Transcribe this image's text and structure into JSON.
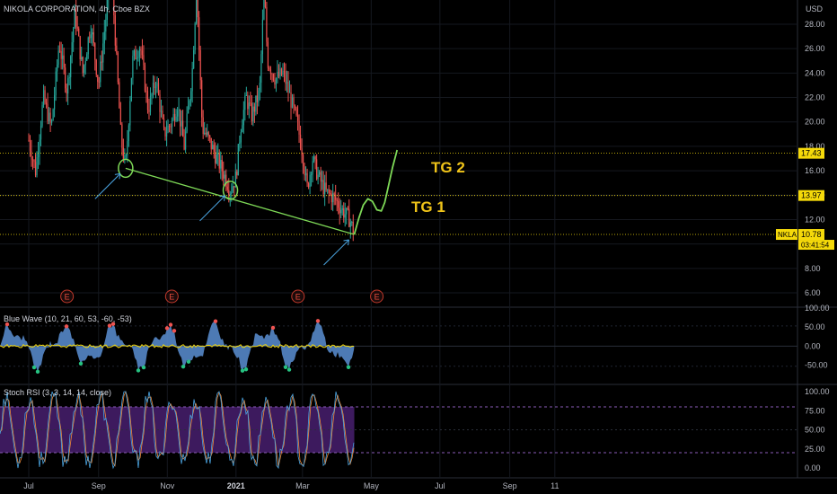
{
  "chart_data": [
    {
      "type": "candlestick",
      "title": "NIKOLA CORPORATION, 4h, Cboe BZX",
      "currency": "USD",
      "x_ticks": [
        "Jul",
        "Sep",
        "Nov",
        "2021",
        "Mar",
        "May",
        "Jul",
        "Sep",
        "11"
      ],
      "y_ticks": [
        6.0,
        8.0,
        10.0,
        12.0,
        14.0,
        16.0,
        18.0,
        20.0,
        22.0,
        24.0,
        26.0,
        28.0
      ],
      "ylim": [
        5.0,
        29.3
      ],
      "price_levels": [
        {
          "label": "17.43",
          "value": 17.43,
          "color": "#f5d90a"
        },
        {
          "label": "13.97",
          "value": 13.97,
          "color": "#f5d90a"
        },
        {
          "label": "10.78",
          "value": 10.78,
          "color": "#f5d90a"
        }
      ],
      "last_price": {
        "symbol": "NKLA",
        "price": "10.78",
        "countdown": "03:41:54"
      },
      "price_path": [
        [
          "2020-07-01",
          18.5
        ],
        [
          "2020-07-07",
          16.0
        ],
        [
          "2020-07-14",
          22.0
        ],
        [
          "2020-07-21",
          19.5
        ],
        [
          "2020-07-28",
          26.5
        ],
        [
          "2020-08-04",
          22.5
        ],
        [
          "2020-08-11",
          29.0
        ],
        [
          "2020-08-18",
          24.0
        ],
        [
          "2020-08-25",
          28.0
        ],
        [
          "2020-09-01",
          23.0
        ],
        [
          "2020-09-08",
          29.0
        ],
        [
          "2020-09-12",
          33.0
        ],
        [
          "2020-09-21",
          18.5
        ],
        [
          "2020-09-25",
          16.2
        ],
        [
          "2020-10-01",
          25.0
        ],
        [
          "2020-10-08",
          26.3
        ],
        [
          "2020-10-15",
          21.0
        ],
        [
          "2020-10-22",
          23.5
        ],
        [
          "2020-10-29",
          19.0
        ],
        [
          "2020-11-05",
          20.0
        ],
        [
          "2020-11-10",
          21.5
        ],
        [
          "2020-11-16",
          18.0
        ],
        [
          "2020-11-23",
          24.0
        ],
        [
          "2020-11-27",
          31.0
        ],
        [
          "2020-12-02",
          19.5
        ],
        [
          "2020-12-08",
          18.5
        ],
        [
          "2020-12-14",
          17.2
        ],
        [
          "2020-12-20",
          16.0
        ],
        [
          "2020-12-27",
          14.4
        ],
        [
          "2021-01-01",
          15.5
        ],
        [
          "2021-01-05",
          19.5
        ],
        [
          "2021-01-10",
          22.0
        ],
        [
          "2021-01-15",
          20.5
        ],
        [
          "2021-01-22",
          22.5
        ],
        [
          "2021-01-26",
          31.0
        ],
        [
          "2021-01-29",
          25.0
        ],
        [
          "2021-02-05",
          23.5
        ],
        [
          "2021-02-12",
          24.0
        ],
        [
          "2021-02-18",
          22.0
        ],
        [
          "2021-02-24",
          20.0
        ],
        [
          "2021-03-01",
          17.5
        ],
        [
          "2021-03-05",
          14.5
        ],
        [
          "2021-03-10",
          17.0
        ],
        [
          "2021-03-15",
          15.5
        ],
        [
          "2021-03-22",
          14.2
        ],
        [
          "2021-03-29",
          13.8
        ],
        [
          "2021-04-05",
          12.8
        ],
        [
          "2021-04-12",
          12.0
        ],
        [
          "2021-04-16",
          10.78
        ]
      ],
      "trend_line": [
        [
          "2020-09-25",
          16.2
        ],
        [
          "2021-04-16",
          10.78
        ]
      ],
      "target_path": [
        [
          "2021-04-16",
          10.78
        ],
        [
          "2021-04-20",
          12.1
        ],
        [
          "2021-04-24",
          13.2
        ],
        [
          "2021-04-28",
          13.7
        ],
        [
          "2021-05-02",
          13.5
        ],
        [
          "2021-05-06",
          12.8
        ],
        [
          "2021-05-10",
          12.7
        ],
        [
          "2021-05-13",
          13.4
        ],
        [
          "2021-05-16",
          14.6
        ],
        [
          "2021-05-20",
          16.3
        ],
        [
          "2021-05-24",
          17.7
        ]
      ],
      "circle_markers": [
        [
          "2020-09-25",
          16.2
        ],
        [
          "2020-12-27",
          14.4
        ]
      ],
      "arrow_markers": [
        [
          "2020-09-25",
          16.2
        ],
        [
          "2020-12-27",
          14.4
        ],
        [
          "2021-04-16",
          10.78
        ]
      ],
      "annotations": [
        {
          "text": "TG 1",
          "color": "#f0c419"
        },
        {
          "text": "TG 2",
          "color": "#f0c419"
        }
      ],
      "earnings_markers": [
        {
          "label": "E",
          "date": "2020-08-04"
        },
        {
          "label": "E",
          "date": "2020-11-05"
        },
        {
          "label": "E",
          "date": "2021-02-25"
        },
        {
          "label": "E",
          "date": "2021-05-06"
        }
      ],
      "colors": {
        "up": "#26a69a",
        "down": "#ef5350",
        "trend_line": "#7ed957",
        "price_level": "#f5d90a",
        "circle": "#7ed957",
        "arrow": "#4aa3df"
      }
    },
    {
      "type": "area",
      "title": "Blue Wave (10, 21, 60, 53, -60, -53)",
      "y_ticks": [
        100.0,
        50.0,
        0.0,
        -50.0
      ],
      "y_tick_labels": [
        "100.00",
        "50.00",
        "0.00",
        "-50.00"
      ],
      "ylim": [
        -80,
        110
      ],
      "levels": [
        53,
        -53
      ],
      "colors": {
        "fill": "#5b8fd4",
        "signal": "#f5d90a",
        "overbought_dot": "#ef5350",
        "oversold_dot": "#26c281"
      }
    },
    {
      "type": "line",
      "title": "Stoch RSI (3, 3, 14, 14, close)",
      "y_ticks": [
        100.0,
        75.0,
        50.0,
        25.0,
        0.0
      ],
      "y_tick_labels": [
        "100.00",
        "75.00",
        "50.00",
        "25.00",
        "0.00"
      ],
      "ylim": [
        -5,
        105
      ],
      "band": [
        20,
        80
      ],
      "colors": {
        "k": "#4aa3df",
        "d": "#ef8a3a",
        "band": "#3d1a5e",
        "band_edge": "#8a5cb8"
      }
    }
  ]
}
